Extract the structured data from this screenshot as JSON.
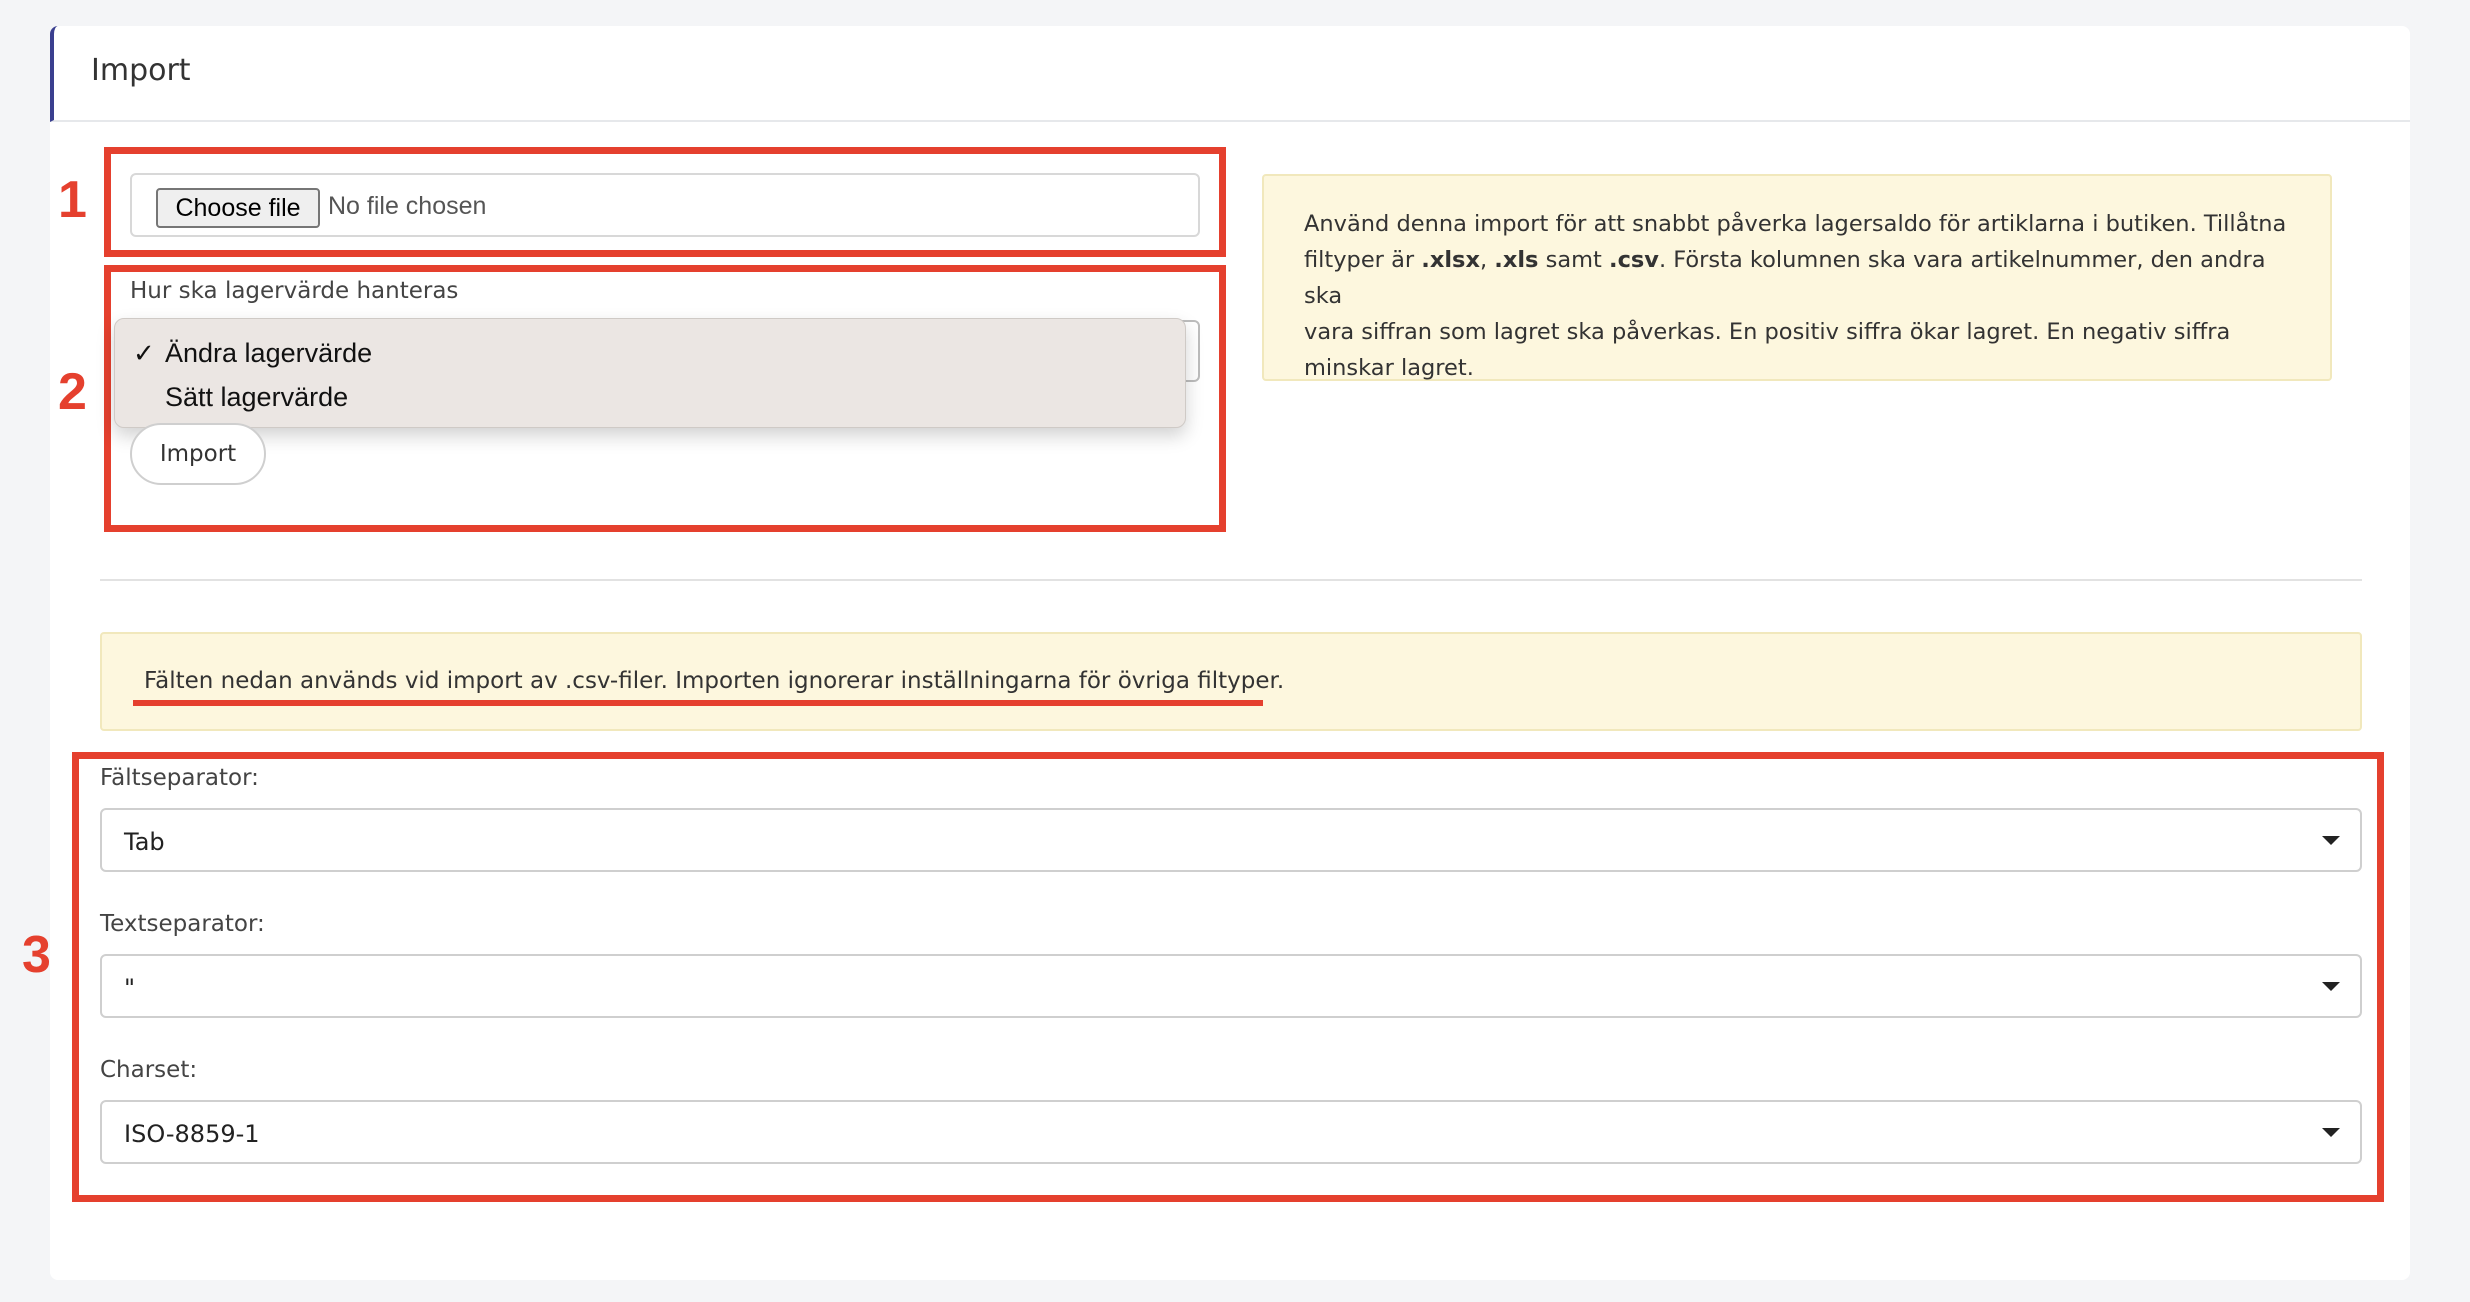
{
  "header": {
    "title": "Import"
  },
  "annotations": {
    "n1": "1",
    "n2": "2",
    "n3": "3"
  },
  "file_input": {
    "button_label": "Choose file",
    "status": "No file chosen"
  },
  "stock_mode": {
    "label": "Hur ska lagervärde hanteras",
    "options": [
      {
        "label": "Ändra lagervärde",
        "selected": true,
        "check": "✓"
      },
      {
        "label": "Sätt lagervärde",
        "selected": false,
        "check": ""
      }
    ]
  },
  "import_button": {
    "label": "Import"
  },
  "info": {
    "p1": "Använd denna import för att snabbt påverka lagersaldo för artiklarna i butiken. Tillåtna",
    "p2a": "filtyper är ",
    "p2b": ".xlsx",
    "p2c": ", ",
    "p2d": ".xls",
    "p2e": " samt ",
    "p2f": ".csv",
    "p2g": ". Första kolumnen ska vara artikelnummer, den andra ska",
    "p3": "vara siffran som lagret ska påverkas. En positiv siffra ökar lagret. En negativ siffra",
    "p4": "minskar lagret."
  },
  "csv_notice": {
    "text": "Fälten nedan används vid import av .csv-filer. Importen ignorerar inställningarna för övriga filtyper."
  },
  "csv_settings": {
    "field_separator": {
      "label": "Fältseparator:",
      "value": "Tab"
    },
    "text_separator": {
      "label": "Textseparator:",
      "value": "\""
    },
    "charset": {
      "label": "Charset:",
      "value": "ISO-8859-1"
    }
  },
  "colors": {
    "annotation": "#e5402e",
    "accent": "#3a3f8f",
    "info_bg": "#fdf7de"
  }
}
